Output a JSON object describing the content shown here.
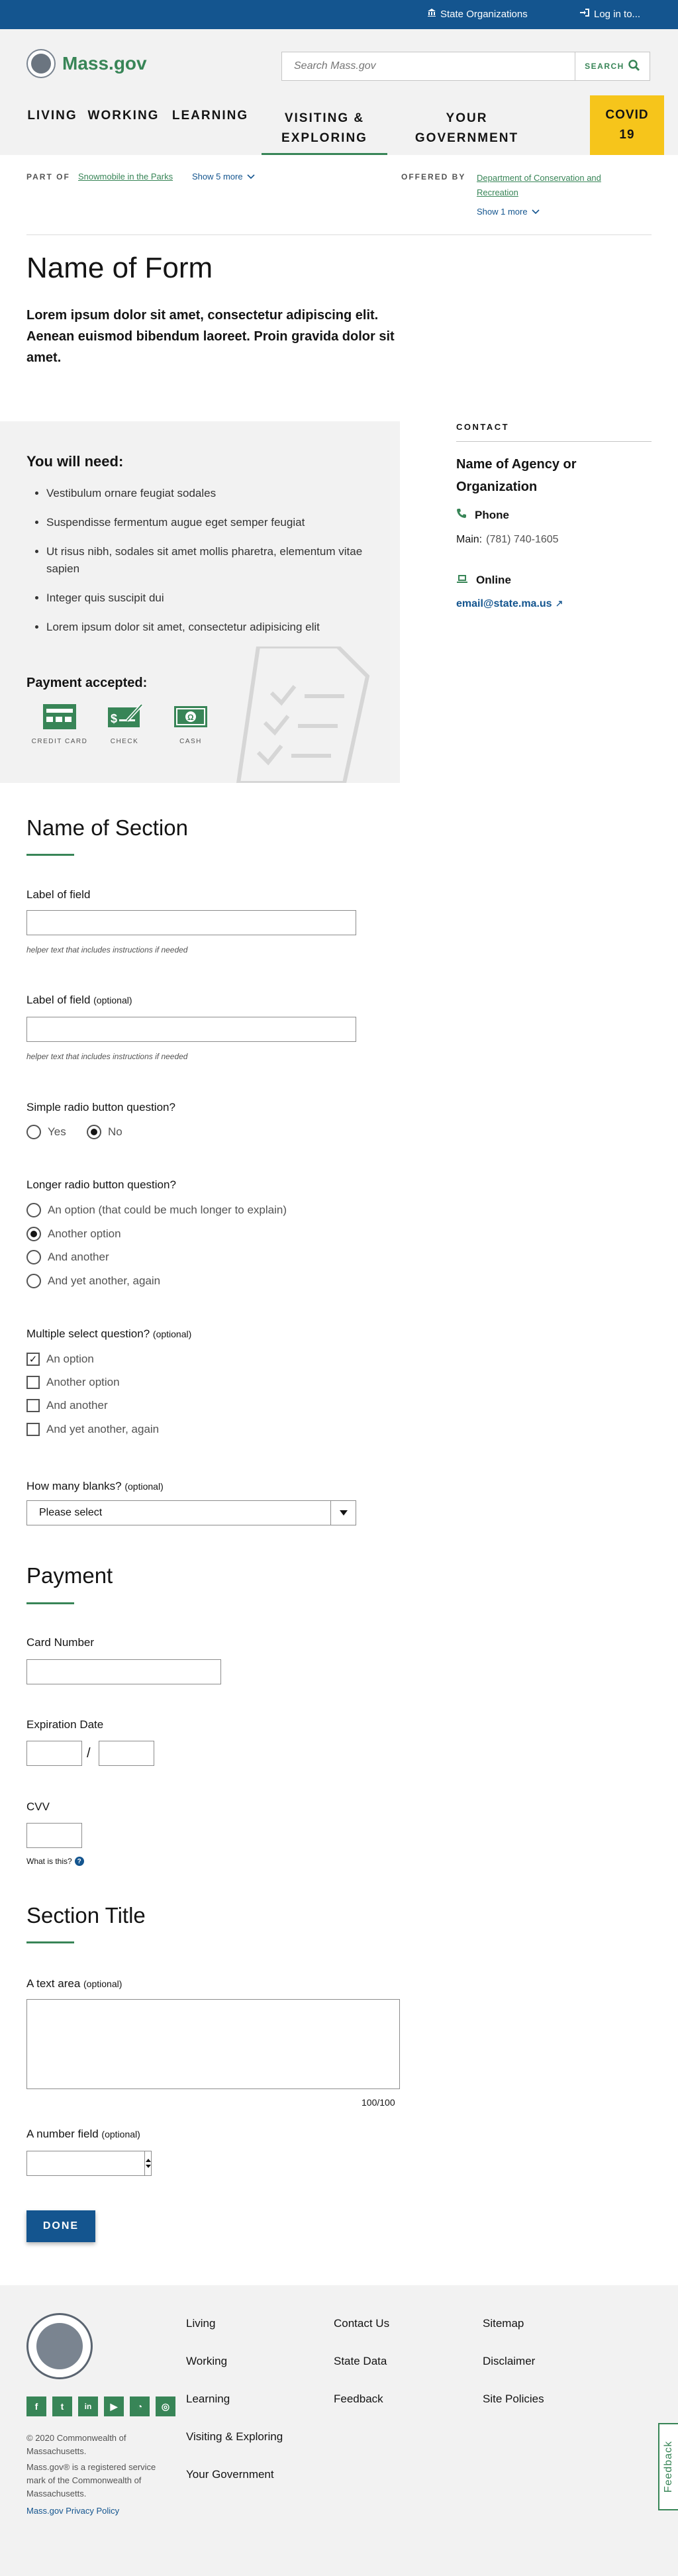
{
  "utility": {
    "state_orgs": "State Organizations",
    "login": "Log in to..."
  },
  "header": {
    "logo_text": "Mass.gov",
    "search_placeholder": "Search Mass.gov",
    "search_button": "SEARCH",
    "nav": [
      "LIVING",
      "WORKING",
      "LEARNING",
      "VISITING &",
      "EXPLORING",
      "YOUR",
      "GOVERNMENT"
    ],
    "covid": [
      "COVID",
      "19"
    ]
  },
  "relationship": {
    "part_of_label": "PART OF",
    "part_of_link": "Snowmobile in the Parks",
    "part_of_more": "Show 5 more",
    "offered_by_label": "OFFERED BY",
    "offered_by_link": [
      "Department of Conservation and",
      "Recreation"
    ],
    "offered_by_more": "Show 1 more"
  },
  "page": {
    "title": "Name of Form",
    "lede": "Lorem ipsum dolor sit amet, consectetur adipiscing elit. Aenean euismod bibendum laoreet. Proin gravida dolor sit amet."
  },
  "need": {
    "title": "You will need:",
    "items": [
      "Vestibulum ornare feugiat sodales",
      "Suspendisse fermentum augue eget semper feugiat",
      "Ut risus nibh, sodales sit amet mollis pharetra, elementum vitae sapien",
      "Integer quis suscipit dui",
      "Lorem ipsum dolor sit amet, consectetur adipisicing elit"
    ],
    "payment_title": "Payment accepted:",
    "payment_methods": [
      "CREDIT CARD",
      "CHECK",
      "CASH"
    ]
  },
  "contact": {
    "label": "CONTACT",
    "agency": [
      "Name of Agency or",
      "Organization"
    ],
    "phone_label": "Phone",
    "phone_main_label": "Main:",
    "phone_number": "(781) 740-1605",
    "online_label": "Online",
    "email": "email@state.ma.us"
  },
  "section1": {
    "title": "Name of Section",
    "field1_label": "Label of field",
    "field1_helper": "helper text that includes instructions if needed",
    "field2_label": "Label of field",
    "field2_optional": "(optional)",
    "field2_helper": "helper text that includes instructions if needed",
    "radio_simple_label": "Simple radio button question?",
    "radio_simple_options": [
      "Yes",
      "No"
    ],
    "radio_simple_selected": "No",
    "radio_long_label": "Longer radio button question?",
    "radio_long_options": [
      "An option (that could be much longer to explain)",
      "Another option",
      "And another",
      "And yet another, again"
    ],
    "radio_long_selected": "Another option",
    "multi_label": "Multiple select question?",
    "multi_optional": "(optional)",
    "multi_options": [
      "An option",
      "Another option",
      "And another",
      "And yet another, again"
    ],
    "multi_checked": [
      "An option"
    ],
    "blanks_label": "How many blanks?",
    "blanks_optional": "(optional)",
    "blanks_value": "Please select"
  },
  "payment": {
    "title": "Payment",
    "card_label": "Card Number",
    "exp_label": "Expiration Date",
    "exp_sep": "/",
    "cvv_label": "CVV",
    "cvv_help": "What is this?"
  },
  "section3": {
    "title": "Section Title",
    "textarea_label": "A text area",
    "textarea_optional": "(optional)",
    "textarea_count": "100/100",
    "number_label": "A number field",
    "number_optional": "(optional)",
    "done": "DONE"
  },
  "footer": {
    "col1": [
      "Living",
      "Working",
      "Learning",
      "Visiting & Exploring",
      "Your Government"
    ],
    "col2": [
      "Contact Us",
      "State Data",
      "Feedback"
    ],
    "col3": [
      "Sitemap",
      "Disclaimer",
      "Site Policies"
    ],
    "social": [
      "f",
      "t",
      "in",
      "yt",
      "rss",
      "ig"
    ],
    "copyright": [
      "© 2020 Commonwealth of",
      "Massachusetts."
    ],
    "service_mark": [
      "Mass.gov® is a registered service",
      "mark of the Commonwealth of",
      "Massachusetts."
    ],
    "privacy": "Mass.gov Privacy Policy",
    "feedback_tab": "Feedback"
  },
  "colors": {
    "brand_blue": "#14558f",
    "brand_green": "#388557",
    "covid_yellow": "#f6c51b"
  }
}
